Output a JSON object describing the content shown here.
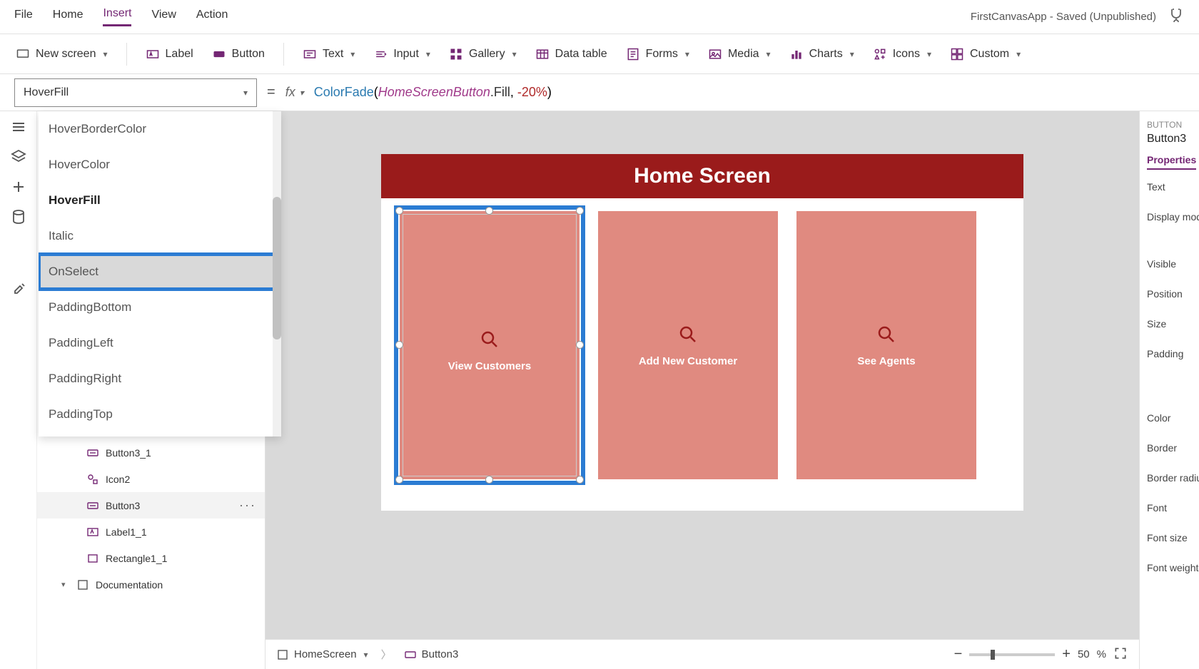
{
  "app_title": "FirstCanvasApp - Saved (Unpublished)",
  "menu": {
    "file": "File",
    "home": "Home",
    "insert": "Insert",
    "view": "View",
    "action": "Action"
  },
  "ribbon": {
    "new_screen": "New screen",
    "label": "Label",
    "button": "Button",
    "text": "Text",
    "input": "Input",
    "gallery": "Gallery",
    "data_table": "Data table",
    "forms": "Forms",
    "media": "Media",
    "charts": "Charts",
    "icons": "Icons",
    "custom": "Custom"
  },
  "property_selector": {
    "value": "HoverFill"
  },
  "formula": {
    "fn": "ColorFade",
    "open": "(",
    "ref": "HomeScreenButton",
    "dotfill": ".Fill",
    "comma": ", ",
    "neg": "-",
    "num": "20%",
    "close": ")"
  },
  "dropdown_items": {
    "i0": "HoverBorderColor",
    "i1": "HoverColor",
    "i2": "HoverFill",
    "i3": "Italic",
    "i4": "OnSelect",
    "i5": "PaddingBottom",
    "i6": "PaddingLeft",
    "i7": "PaddingRight",
    "i8": "PaddingTop"
  },
  "tree": {
    "button3_1": "Button3_1",
    "icon2": "Icon2",
    "button3": "Button3",
    "label1_1": "Label1_1",
    "rectangle1_1": "Rectangle1_1",
    "documentation": "Documentation"
  },
  "canvas": {
    "header": "Home Screen",
    "card1": "View Customers",
    "card2": "Add New Customer",
    "card3": "See Agents"
  },
  "breadcrumb": {
    "screen": "HomeScreen",
    "control": "Button3"
  },
  "zoom": {
    "value": "50",
    "unit": "%"
  },
  "right_pane": {
    "typelabel": "BUTTON",
    "name": "Button3",
    "tab": "Properties",
    "text": "Text",
    "display_mode": "Display mode",
    "visible": "Visible",
    "position": "Position",
    "size": "Size",
    "padding": "Padding",
    "color": "Color",
    "border": "Border",
    "border_radius": "Border radius",
    "font": "Font",
    "font_size": "Font size",
    "font_weight": "Font weight"
  },
  "cursor_text": "OnSelect"
}
